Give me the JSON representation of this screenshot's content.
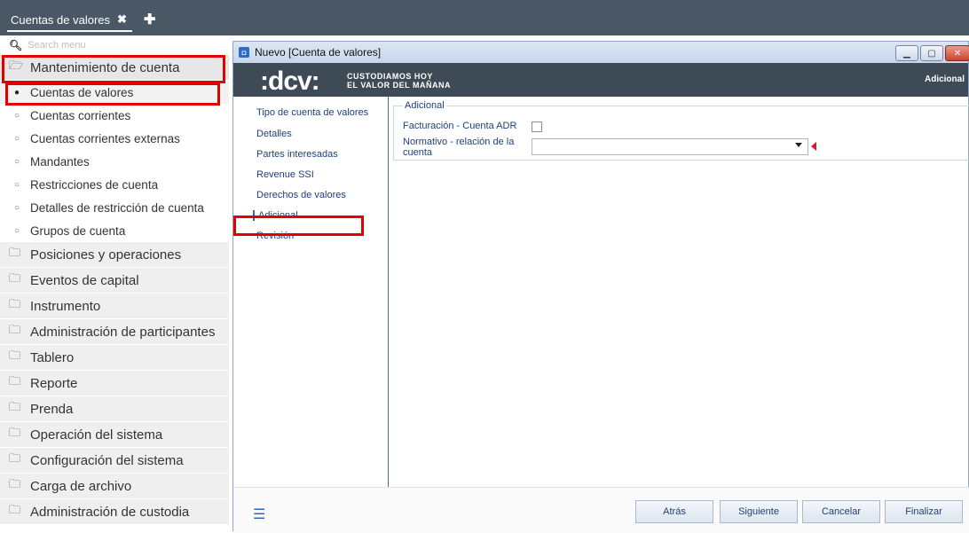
{
  "tabbar": {
    "tab_label": "Cuentas de valores",
    "close_glyph": "✖",
    "add_glyph": "✚"
  },
  "menu": {
    "search_placeholder": "Search menu",
    "open_section": "Mantenimiento de cuenta",
    "subitems": [
      "Cuentas de valores",
      "Cuentas corrientes",
      "Cuentas corrientes externas",
      "Mandantes",
      "Restricciones de cuenta",
      "Detalles de restricción de cuenta",
      "Grupos de cuenta"
    ],
    "sections": [
      "Posiciones y operaciones",
      "Eventos de capital",
      "Instrumento",
      "Administración de participantes",
      "Tablero",
      "Reporte",
      "Prenda",
      "Operación del sistema",
      "Configuración del sistema",
      "Carga de archivo",
      "Administración de custodia"
    ]
  },
  "window": {
    "title": "Nuevo [Cuenta de valores]",
    "brand_logo": ":dcv:",
    "brand_line1": "CUSTODIAMOS HOY",
    "brand_line2": "EL VALOR DEL MAÑANA",
    "banner_right": "Adicional",
    "nav": [
      "Tipo de cuenta de valores",
      "Detalles",
      "Partes interesadas",
      "Revenue SSI",
      "Derechos de valores",
      "Adicional",
      "Revisión"
    ],
    "section_title": "Adicional",
    "field_billing": "Facturación - Cuenta ADR",
    "field_normativo": "Normativo - relación de la cuenta",
    "buttons": {
      "back": "Atrás",
      "next": "Siguiente",
      "cancel": "Cancelar",
      "finish": "Finalizar"
    }
  },
  "colors": {
    "highlight_red": "#e10000",
    "topbar": "#4a5866",
    "banner": "#3e4b57",
    "required_marker": "#d9192b"
  }
}
